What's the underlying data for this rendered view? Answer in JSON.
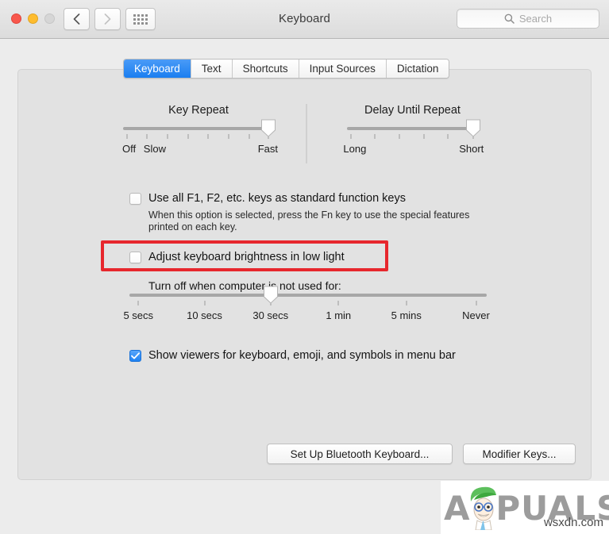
{
  "window": {
    "title": "Keyboard",
    "traffic_lights": [
      "close-red",
      "minimize-yellow",
      "zoom-disabled"
    ],
    "nav": {
      "back_icon": "chevron-left",
      "forward_icon": "chevron-right",
      "grid_icon": "show-all-grid"
    },
    "search": {
      "placeholder": "Search",
      "icon": "search-icon",
      "value": ""
    }
  },
  "tabs": [
    {
      "label": "Keyboard",
      "active": true
    },
    {
      "label": "Text",
      "active": false
    },
    {
      "label": "Shortcuts",
      "active": false
    },
    {
      "label": "Input Sources",
      "active": false
    },
    {
      "label": "Dictation",
      "active": false
    }
  ],
  "key_repeat": {
    "title": "Key Repeat",
    "tick_count": 8,
    "value_index": 7,
    "labels": [
      {
        "text": "Off",
        "pos": 0
      },
      {
        "text": "Slow",
        "pos": 1
      },
      {
        "text": "Fast",
        "pos": 7
      }
    ]
  },
  "delay_until_repeat": {
    "title": "Delay Until Repeat",
    "tick_count": 6,
    "value_index": 5,
    "labels": [
      {
        "text": "Long",
        "pos": 0
      },
      {
        "text": "Short",
        "pos": 5
      }
    ]
  },
  "function_keys": {
    "checked": false,
    "label": "Use all F1, F2, etc. keys as standard function keys",
    "description": "When this option is selected, press the Fn key to use the special features printed on each key."
  },
  "brightness": {
    "checked": false,
    "label": "Adjust keyboard brightness in low light",
    "highlighted": true,
    "highlight_color": "#e7272d"
  },
  "turn_off": {
    "label": "Turn off when computer is not used for:",
    "tick_count": 6,
    "value_index": 2,
    "labels": [
      "5 secs",
      "10 secs",
      "30 secs",
      "1 min",
      "5 mins",
      "Never"
    ]
  },
  "viewers": {
    "checked": true,
    "label": "Show viewers for keyboard, emoji, and symbols in menu bar"
  },
  "buttons": {
    "bluetooth": "Set Up Bluetooth Keyboard...",
    "modifier": "Modifier Keys..."
  },
  "watermark": {
    "brand": "APPUALS",
    "brand_prefix": "A",
    "brand_suffix": "PUALS",
    "url": "wsxdn.com"
  }
}
